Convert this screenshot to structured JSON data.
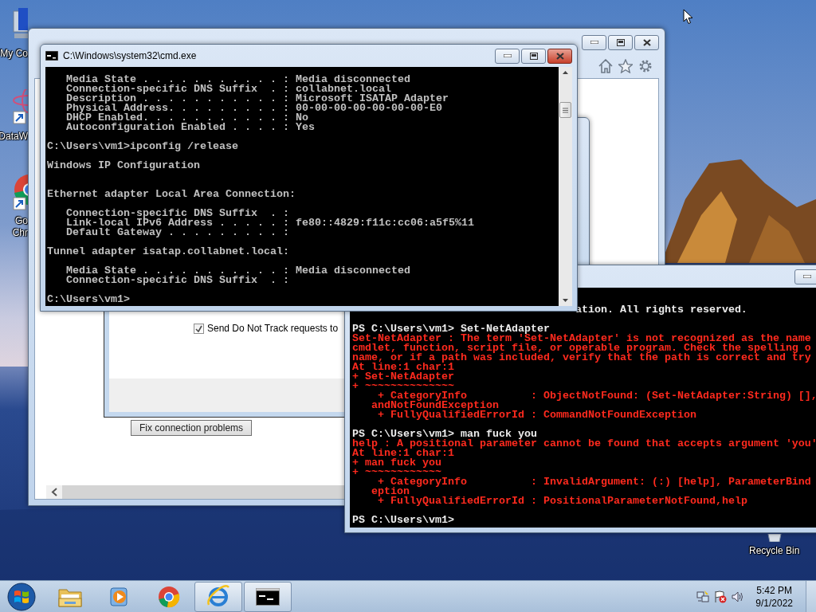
{
  "desktop_icons": [
    {
      "kind": "computer",
      "label": "My Co"
    },
    {
      "kind": "atom-shortcut",
      "label": "DataW"
    },
    {
      "kind": "chrome-shortcut",
      "label": "Go\nChr"
    }
  ],
  "recycle_bin": {
    "label": "Recycle Bin"
  },
  "ie_window": {
    "dialog": {
      "checkbox": {
        "label": "Send Do Not Track requests to",
        "checked": true
      }
    },
    "button": "Fix connection problems"
  },
  "cmd_window": {
    "title": "C:\\Windows\\system32\\cmd.exe",
    "blocks": [
      {
        "kind": "section",
        "lines": [
          "   Media State . . . . . . . . . . . : Media disconnected",
          "   Connection-specific DNS Suffix  . : collabnet.local",
          "   Description . . . . . . . . . . . : Microsoft ISATAP Adapter",
          "   Physical Address. . . . . . . . . : 00-00-00-00-00-00-00-E0",
          "   DHCP Enabled. . . . . . . . . . . : No",
          "   Autoconfiguration Enabled . . . . : Yes"
        ]
      },
      {
        "kind": "section",
        "lines": [
          "C:\\Users\\vm1>ipconfig /release"
        ]
      },
      {
        "kind": "title",
        "lines": [
          "Windows IP Configuration"
        ]
      },
      {
        "kind": "section",
        "lines": [
          "Ethernet adapter Local Area Connection:"
        ]
      },
      {
        "kind": "section",
        "lines": [
          "   Connection-specific DNS Suffix  . :",
          "   Link-local IPv6 Address . . . . . : fe80::4829:f11c:cc06:a5f5%11",
          "   Default Gateway . . . . . . . . . :"
        ]
      },
      {
        "kind": "section",
        "lines": [
          "Tunnel adapter isatap.collabnet.local:"
        ]
      },
      {
        "kind": "section",
        "lines": [
          "   Media State . . . . . . . . . . . : Media disconnected",
          "   Connection-specific DNS Suffix  . :"
        ]
      },
      {
        "kind": "section",
        "lines": [
          "C:\\Users\\vm1>"
        ]
      }
    ]
  },
  "powershell_window": {
    "blocks": [
      [
        {
          "kind": "clipped",
          "text": "ation. All rights reserved."
        }
      ],
      [
        {
          "kind": "input",
          "text": "PS C:\\Users\\vm1> Set-NetAdapter"
        },
        {
          "kind": "error",
          "text": "Set-NetAdapter : The term 'Set-NetAdapter' is not recognized as the name"
        },
        {
          "kind": "error",
          "text": "cmdlet, function, script file, or operable program. Check the spelling o"
        },
        {
          "kind": "error",
          "text": "name, or if a path was included, verify that the path is correct and try"
        },
        {
          "kind": "error",
          "text": "At line:1 char:1"
        },
        {
          "kind": "error",
          "text": "+ Set-NetAdapter"
        },
        {
          "kind": "error",
          "text": "+ ~~~~~~~~~~~~~~"
        },
        {
          "kind": "error",
          "text": "    + CategoryInfo          : ObjectNotFound: (Set-NetAdapter:String) [],"
        },
        {
          "kind": "error",
          "text": "   andNotFoundException"
        },
        {
          "kind": "error",
          "text": "    + FullyQualifiedErrorId : CommandNotFoundException"
        }
      ],
      [
        {
          "kind": "input",
          "text": "PS C:\\Users\\vm1> man fuck you"
        },
        {
          "kind": "error",
          "text": "help : A positional parameter cannot be found that accepts argument 'you'"
        },
        {
          "kind": "error",
          "text": "At line:1 char:1"
        },
        {
          "kind": "error",
          "text": "+ man fuck you"
        },
        {
          "kind": "error",
          "text": "+ ~~~~~~~~~~~~"
        },
        {
          "kind": "error",
          "text": "    + CategoryInfo          : InvalidArgument: (:) [help], ParameterBind"
        },
        {
          "kind": "error",
          "text": "   eption"
        },
        {
          "kind": "error",
          "text": "    + FullyQualifiedErrorId : PositionalParameterNotFound,help"
        }
      ],
      [
        {
          "kind": "input",
          "text": "PS C:\\Users\\vm1>"
        }
      ]
    ]
  },
  "taskbar": {
    "apps": [
      {
        "kind": "explorer",
        "running": false
      },
      {
        "kind": "media",
        "running": false
      },
      {
        "kind": "chrome",
        "running": false
      },
      {
        "kind": "ie",
        "running": true
      },
      {
        "kind": "cmd",
        "running": true
      }
    ],
    "clock": {
      "time": "5:42 PM",
      "date": "9/1/2022"
    }
  }
}
